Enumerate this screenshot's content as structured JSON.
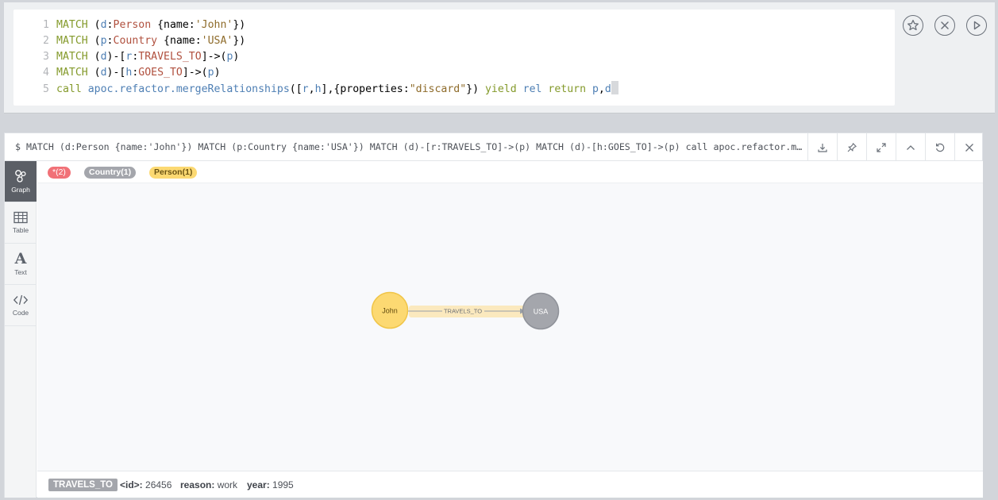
{
  "editor": {
    "lines": [
      {
        "num": "1",
        "tokens": [
          [
            "kw",
            "MATCH "
          ],
          [
            "txt",
            "("
          ],
          [
            "var",
            "d"
          ],
          [
            "txt",
            ":"
          ],
          [
            "label",
            "Person"
          ],
          [
            "txt",
            " {name:"
          ],
          [
            "str",
            "'John'"
          ],
          [
            "txt",
            "})"
          ]
        ]
      },
      {
        "num": "2",
        "tokens": [
          [
            "kw",
            "MATCH "
          ],
          [
            "txt",
            "("
          ],
          [
            "var",
            "p"
          ],
          [
            "txt",
            ":"
          ],
          [
            "label",
            "Country"
          ],
          [
            "txt",
            " {name:"
          ],
          [
            "str",
            "'USA'"
          ],
          [
            "txt",
            "})"
          ]
        ]
      },
      {
        "num": "3",
        "tokens": [
          [
            "kw",
            "MATCH "
          ],
          [
            "txt",
            "("
          ],
          [
            "var",
            "d"
          ],
          [
            "txt",
            ")-["
          ],
          [
            "var",
            "r"
          ],
          [
            "txt",
            ":"
          ],
          [
            "label",
            "TRAVELS_TO"
          ],
          [
            "txt",
            "]->("
          ],
          [
            "var",
            "p"
          ],
          [
            "txt",
            ")"
          ]
        ]
      },
      {
        "num": "4",
        "tokens": [
          [
            "kw",
            "MATCH "
          ],
          [
            "txt",
            "("
          ],
          [
            "var",
            "d"
          ],
          [
            "txt",
            ")-["
          ],
          [
            "var",
            "h"
          ],
          [
            "txt",
            ":"
          ],
          [
            "label",
            "GOES_TO"
          ],
          [
            "txt",
            "]->("
          ],
          [
            "var",
            "p"
          ],
          [
            "txt",
            ")"
          ]
        ]
      },
      {
        "num": "5",
        "tokens": [
          [
            "kw",
            "call "
          ],
          [
            "var",
            "apoc.refactor.mergeRelationships"
          ],
          [
            "txt",
            "(["
          ],
          [
            "var",
            "r"
          ],
          [
            "txt",
            ","
          ],
          [
            "var",
            "h"
          ],
          [
            "txt",
            "],{properties:"
          ],
          [
            "str",
            "\"discard\""
          ],
          [
            "txt",
            "}) "
          ],
          [
            "kw",
            "yield "
          ],
          [
            "var",
            "rel "
          ],
          [
            "kw",
            "return "
          ],
          [
            "var",
            "p"
          ],
          [
            "txt",
            ","
          ],
          [
            "var",
            "d"
          ]
        ]
      }
    ],
    "buttons": {
      "favorite": "star-icon",
      "clear": "close-circle-icon",
      "run": "play-icon"
    }
  },
  "result": {
    "query": "$ MATCH (d:Person {name:'John'}) MATCH (p:Country {name:'USA'}) MATCH (d)-[r:TRAVELS_TO]->(p) MATCH (d)-[h:GOES_TO]->(p) call apoc.refactor.mergeRelationships([r,h],{properties:\"discard\"}) yield rel return p,d",
    "header_buttons": [
      "download-icon",
      "pin-icon",
      "expand-icon",
      "collapse-icon",
      "rerun-icon",
      "close-icon"
    ],
    "sidebar": [
      {
        "label": "Graph",
        "icon": "graph-icon",
        "active": true
      },
      {
        "label": "Table",
        "icon": "table-icon",
        "active": false
      },
      {
        "label": "Text",
        "icon": "text-icon",
        "active": false
      },
      {
        "label": "Code",
        "icon": "code-icon",
        "active": false
      }
    ],
    "legend": {
      "relationships": "*(2)",
      "country": "Country(1)",
      "person": "Person(1)"
    },
    "graph": {
      "nodes": [
        {
          "caption": "John",
          "label": "Person",
          "color": "#fcd972",
          "border": "#f0c548",
          "text_color": "#604a0e"
        },
        {
          "caption": "USA",
          "label": "Country",
          "color": "#a4a6ac",
          "border": "#8f9299",
          "text_color": "#ffffff"
        }
      ],
      "relationship": {
        "type": "TRAVELS_TO",
        "highlight": "#fbe9be"
      }
    },
    "details": {
      "type": "TRAVELS_TO",
      "props": [
        {
          "key": "<id>:",
          "value": "26456"
        },
        {
          "key": "reason:",
          "value": "work"
        },
        {
          "key": "year:",
          "value": "1995"
        }
      ]
    }
  }
}
